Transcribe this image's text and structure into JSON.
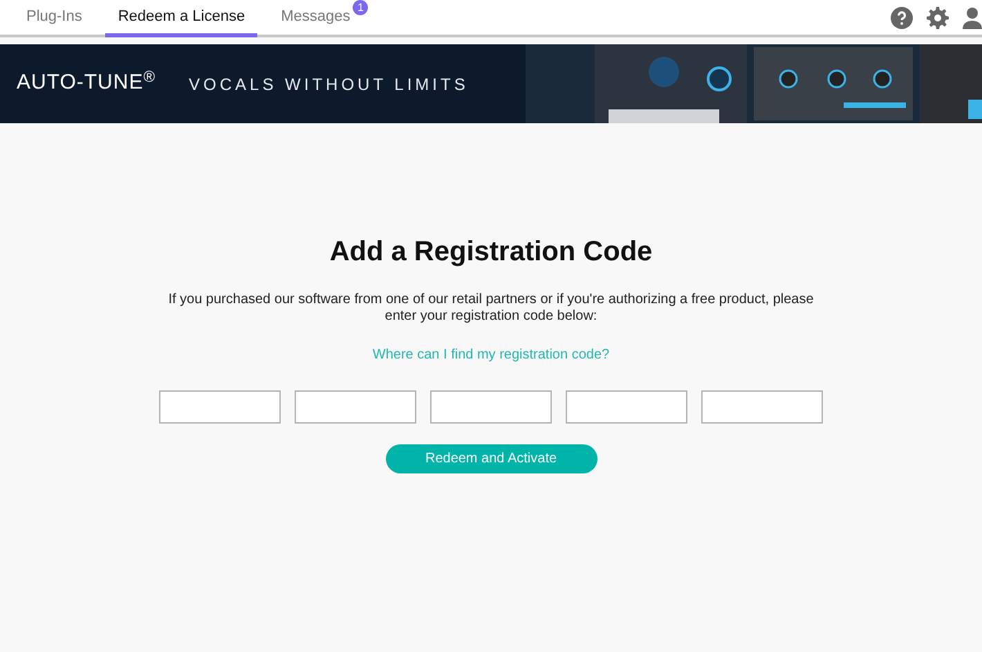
{
  "tabs": [
    {
      "label": "Plug-Ins",
      "selected": false
    },
    {
      "label": "Redeem a License",
      "selected": true
    },
    {
      "label": "Messages",
      "selected": false,
      "badge": "1"
    }
  ],
  "banner": {
    "logo": "AUTO-TUNE$^{®}$",
    "tagline": "VOCALS WITHOUT LIMITS"
  },
  "form": {
    "title": "Add a Registration Code",
    "description": "If you purchased our software from one of our retail partners or if you're authorizing a free product, please enter your registration code below:",
    "help_link": "Where can I find my registration code?",
    "code_fields": [
      {
        "kind": "text"
      },
      {
        "kind": "text"
      },
      {
        "kind": "text"
      },
      {
        "kind": "text"
      },
      {
        "kind": "text"
      }
    ],
    "submit": "Redeem and Activate"
  }
}
